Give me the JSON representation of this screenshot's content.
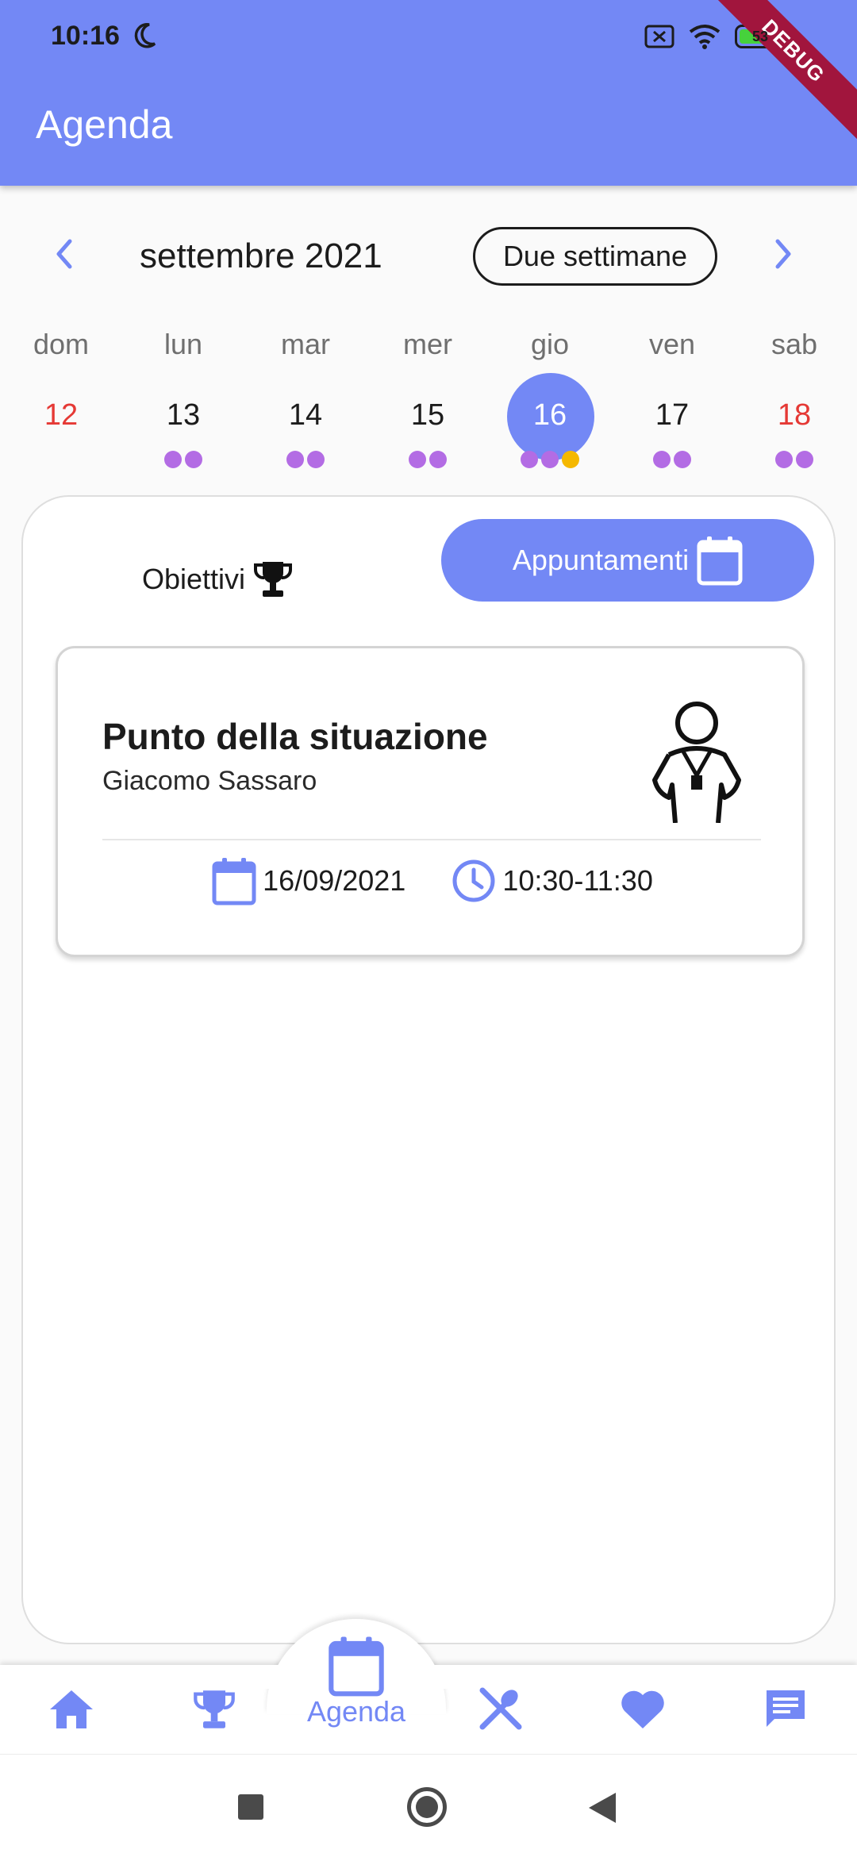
{
  "status_bar": {
    "time": "10:16",
    "battery": "53"
  },
  "app_bar": {
    "title": "Agenda",
    "debug_label": "DEBUG"
  },
  "calendar": {
    "month_label": "settembre 2021",
    "format_button": "Due settimane",
    "days": [
      {
        "weekday": "dom",
        "day": "12",
        "dots": 0,
        "weekend": true
      },
      {
        "weekday": "lun",
        "day": "13",
        "dots": 2,
        "weekend": false
      },
      {
        "weekday": "mar",
        "day": "14",
        "dots": 2,
        "weekend": false
      },
      {
        "weekday": "mer",
        "day": "15",
        "dots": 2,
        "weekend": false
      },
      {
        "weekday": "gio",
        "day": "16",
        "dots": 3,
        "selected": true,
        "weekend": false
      },
      {
        "weekday": "ven",
        "day": "17",
        "dots": 2,
        "weekend": false
      },
      {
        "weekday": "sab",
        "day": "18",
        "dots": 2,
        "weekend": true
      }
    ]
  },
  "tabs": {
    "goals": "Obiettivi",
    "appointments": "Appuntamenti",
    "active": "appointments"
  },
  "appointment": {
    "title": "Punto della situazione",
    "subtitle": "Giacomo Sassaro",
    "date": "16/09/2021",
    "time": "10:30-11:30"
  },
  "bottom_nav": {
    "active_label": "Agenda"
  },
  "colors": {
    "primary": "#7388f5",
    "event_dot": "#b36ce4",
    "highlight_dot": "#f5b800",
    "weekend_text": "#e53935"
  }
}
